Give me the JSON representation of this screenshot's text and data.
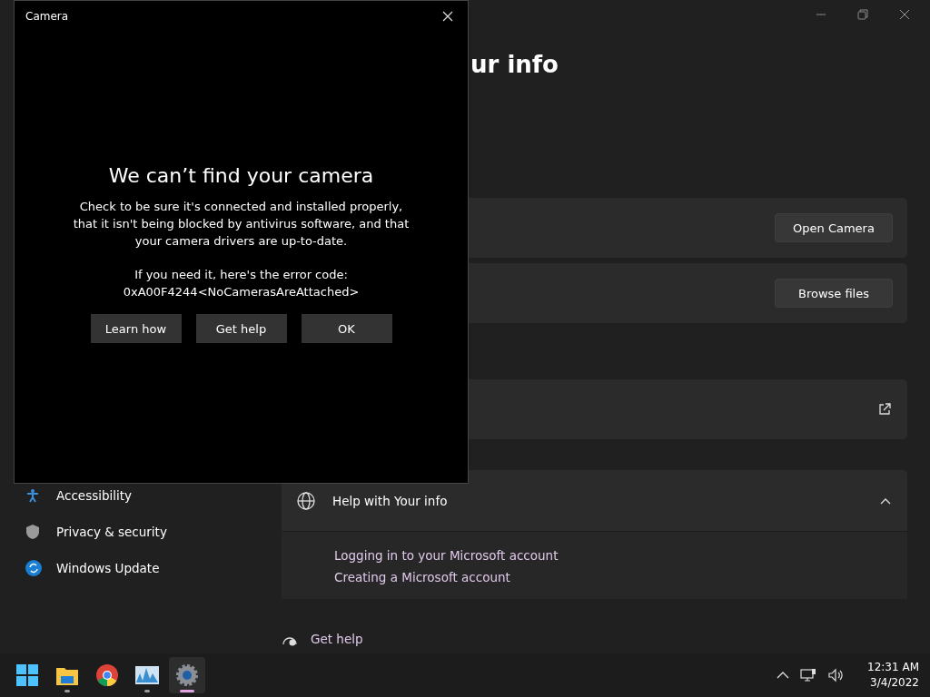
{
  "settings": {
    "title_fragment": "ur info",
    "sidebar": {
      "items": [
        {
          "label": "Accessibility",
          "kind": "accessibility"
        },
        {
          "label": "Privacy & security",
          "kind": "shield"
        },
        {
          "label": "Windows Update",
          "kind": "update"
        }
      ]
    },
    "cards": [
      {
        "kind": "button",
        "button": "Open Camera"
      },
      {
        "kind": "button",
        "button": "Browse files"
      },
      {
        "kind": "external"
      }
    ],
    "help": {
      "title": "Help with Your info",
      "expanded": true,
      "links": [
        "Logging in to your Microsoft account",
        "Creating a Microsoft account"
      ]
    },
    "get_help": "Get help"
  },
  "dialog": {
    "title": "Camera",
    "heading": "We can’t find your camera",
    "message": "Check to be sure it's connected and installed properly, that it isn't being blocked by antivirus software, and that your camera drivers are up-to-date.",
    "code_label": "If you need it, here's the error code:",
    "code": "0xA00F4244<NoCamerasAreAttached>",
    "buttons": [
      "Learn how",
      "Get help",
      "OK"
    ]
  },
  "taskbar": {
    "apps": [
      {
        "kind": "start",
        "running": false,
        "selected": false
      },
      {
        "kind": "folder",
        "running": true,
        "selected": false
      },
      {
        "kind": "browser",
        "running": false,
        "selected": false
      },
      {
        "kind": "monitor",
        "running": true,
        "selected": false
      },
      {
        "kind": "settings",
        "selected": true
      }
    ],
    "time": "12:31 AM",
    "date": "3/4/2022"
  }
}
